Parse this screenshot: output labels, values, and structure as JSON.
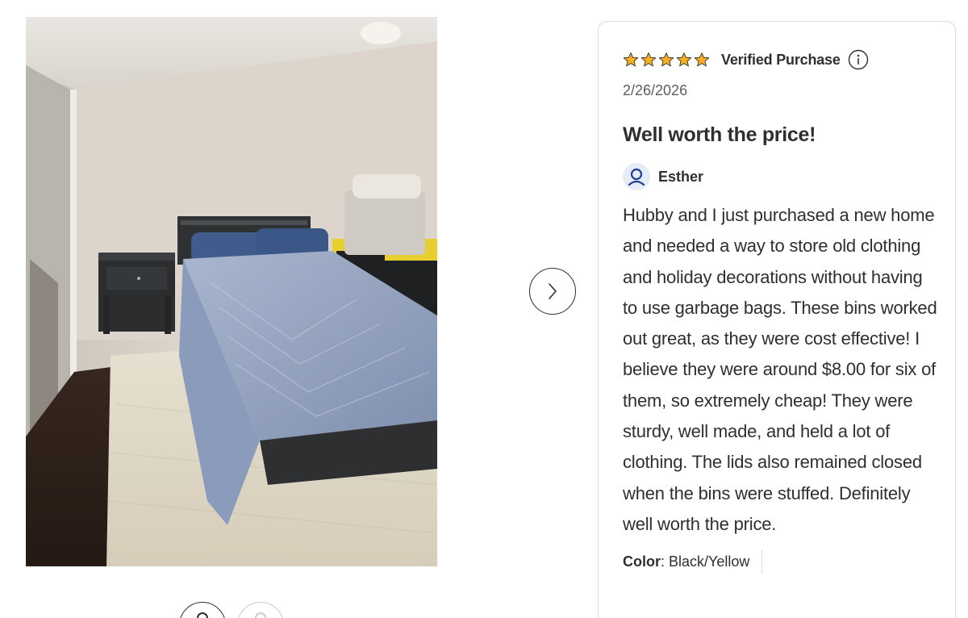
{
  "review": {
    "rating": 5,
    "rating_max": 5,
    "verified_label": "Verified Purchase",
    "date": "2/26/2026",
    "title": "Well worth the price!",
    "reviewer_name": "Esther",
    "body": "Hubby and I just purchased a new home and needed a way to store old clothing and holiday decorations without having to use garbage bags. These bins worked out great, as they were cost effective! I believe they were around $8.00 for six of them, so extremely cheap! They were sturdy, well made, and held a lot of clothing. The lids also remained closed when the bins were stuffed. Definitely well worth the price.",
    "attribute_label": "Color",
    "attribute_value": ": Black/Yellow"
  },
  "gallery": {
    "thumbnail_count": 2,
    "selected_index": 0
  },
  "colors": {
    "star": "#f8b022",
    "text": "#2e2f32",
    "muted_text": "#5c5d60",
    "avatar_bg": "#e6ecf7",
    "avatar_icon": "#1c3f94",
    "border": "#d9dadd"
  },
  "icons": {
    "star": "star-icon",
    "info": "info-icon",
    "avatar": "user-icon",
    "next": "chevron-right-icon"
  }
}
